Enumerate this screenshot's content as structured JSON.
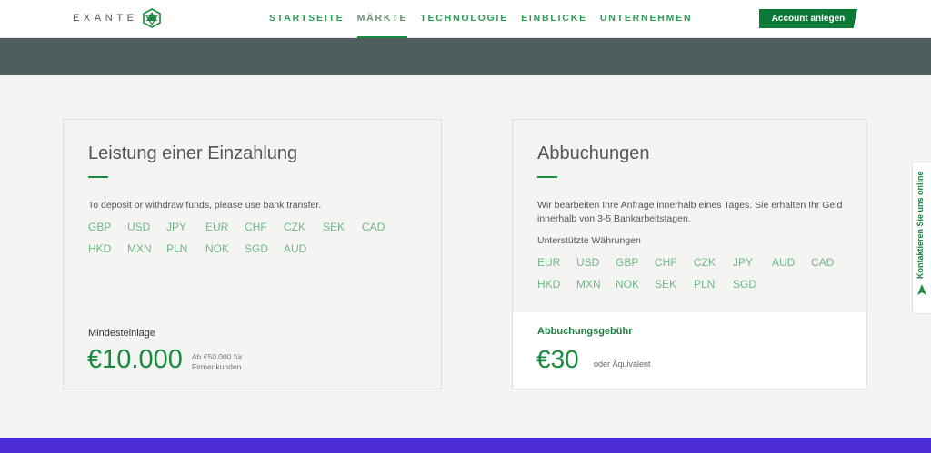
{
  "nav": {
    "logo_text": "EXANTE",
    "items": [
      {
        "label": "STARTSEITE",
        "active": false
      },
      {
        "label": "MÄRKTE",
        "active": true
      },
      {
        "label": "TECHNOLOGIE",
        "active": false
      },
      {
        "label": "EINBLICKE",
        "active": false
      },
      {
        "label": "UNTERNEHMEN",
        "active": false
      }
    ],
    "cta_label": "Account anlegen"
  },
  "deposit": {
    "title": "Leistung einer Einzahlung",
    "description": "To deposit or withdraw funds, please use bank transfer.",
    "currencies": [
      "GBP",
      "USD",
      "JPY",
      "EUR",
      "CHF",
      "CZK",
      "SEK",
      "CAD",
      "HKD",
      "MXN",
      "PLN",
      "NOK",
      "SGD",
      "AUD"
    ],
    "min_label": "Mindesteinlage",
    "min_amount": "€10.000",
    "min_note": "Ab €50.000 für Firmenkunden"
  },
  "withdrawal": {
    "title": "Abbuchungen",
    "description": "Wir bearbeiten Ihre Anfrage innerhalb eines Tages. Sie erhalten Ihr Geld innerhalb von 3-5 Bankarbeitstagen.",
    "supported_label": "Unterstützte Währungen",
    "currencies": [
      "EUR",
      "USD",
      "GBP",
      "CHF",
      "CZK",
      "JPY",
      "AUD",
      "CAD",
      "HKD",
      "MXN",
      "NOK",
      "SEK",
      "PLN",
      "SGD"
    ],
    "fee_label": "Abbuchungsgebühr",
    "fee_amount": "€30",
    "fee_note": "oder Äquivalent"
  },
  "contact_tab": {
    "label": "Kontaktieren Sie uns online",
    "icon": "chat-arrow-icon"
  },
  "colors": {
    "accent": "#1a8a3e",
    "band": "#4f5d5e",
    "footer": "#4b2cd6"
  }
}
